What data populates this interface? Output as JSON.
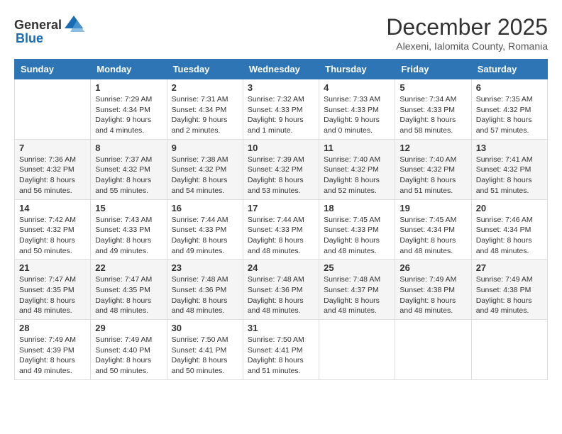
{
  "header": {
    "logo_general": "General",
    "logo_blue": "Blue",
    "month_title": "December 2025",
    "subtitle": "Alexeni, Ialomita County, Romania"
  },
  "days_of_week": [
    "Sunday",
    "Monday",
    "Tuesday",
    "Wednesday",
    "Thursday",
    "Friday",
    "Saturday"
  ],
  "weeks": [
    [
      {
        "day": "",
        "info": ""
      },
      {
        "day": "1",
        "info": "Sunrise: 7:29 AM\nSunset: 4:34 PM\nDaylight: 9 hours\nand 4 minutes."
      },
      {
        "day": "2",
        "info": "Sunrise: 7:31 AM\nSunset: 4:34 PM\nDaylight: 9 hours\nand 2 minutes."
      },
      {
        "day": "3",
        "info": "Sunrise: 7:32 AM\nSunset: 4:33 PM\nDaylight: 9 hours\nand 1 minute."
      },
      {
        "day": "4",
        "info": "Sunrise: 7:33 AM\nSunset: 4:33 PM\nDaylight: 9 hours\nand 0 minutes."
      },
      {
        "day": "5",
        "info": "Sunrise: 7:34 AM\nSunset: 4:33 PM\nDaylight: 8 hours\nand 58 minutes."
      },
      {
        "day": "6",
        "info": "Sunrise: 7:35 AM\nSunset: 4:32 PM\nDaylight: 8 hours\nand 57 minutes."
      }
    ],
    [
      {
        "day": "7",
        "info": "Sunrise: 7:36 AM\nSunset: 4:32 PM\nDaylight: 8 hours\nand 56 minutes."
      },
      {
        "day": "8",
        "info": "Sunrise: 7:37 AM\nSunset: 4:32 PM\nDaylight: 8 hours\nand 55 minutes."
      },
      {
        "day": "9",
        "info": "Sunrise: 7:38 AM\nSunset: 4:32 PM\nDaylight: 8 hours\nand 54 minutes."
      },
      {
        "day": "10",
        "info": "Sunrise: 7:39 AM\nSunset: 4:32 PM\nDaylight: 8 hours\nand 53 minutes."
      },
      {
        "day": "11",
        "info": "Sunrise: 7:40 AM\nSunset: 4:32 PM\nDaylight: 8 hours\nand 52 minutes."
      },
      {
        "day": "12",
        "info": "Sunrise: 7:40 AM\nSunset: 4:32 PM\nDaylight: 8 hours\nand 51 minutes."
      },
      {
        "day": "13",
        "info": "Sunrise: 7:41 AM\nSunset: 4:32 PM\nDaylight: 8 hours\nand 51 minutes."
      }
    ],
    [
      {
        "day": "14",
        "info": "Sunrise: 7:42 AM\nSunset: 4:32 PM\nDaylight: 8 hours\nand 50 minutes."
      },
      {
        "day": "15",
        "info": "Sunrise: 7:43 AM\nSunset: 4:33 PM\nDaylight: 8 hours\nand 49 minutes."
      },
      {
        "day": "16",
        "info": "Sunrise: 7:44 AM\nSunset: 4:33 PM\nDaylight: 8 hours\nand 49 minutes."
      },
      {
        "day": "17",
        "info": "Sunrise: 7:44 AM\nSunset: 4:33 PM\nDaylight: 8 hours\nand 48 minutes."
      },
      {
        "day": "18",
        "info": "Sunrise: 7:45 AM\nSunset: 4:33 PM\nDaylight: 8 hours\nand 48 minutes."
      },
      {
        "day": "19",
        "info": "Sunrise: 7:45 AM\nSunset: 4:34 PM\nDaylight: 8 hours\nand 48 minutes."
      },
      {
        "day": "20",
        "info": "Sunrise: 7:46 AM\nSunset: 4:34 PM\nDaylight: 8 hours\nand 48 minutes."
      }
    ],
    [
      {
        "day": "21",
        "info": "Sunrise: 7:47 AM\nSunset: 4:35 PM\nDaylight: 8 hours\nand 48 minutes."
      },
      {
        "day": "22",
        "info": "Sunrise: 7:47 AM\nSunset: 4:35 PM\nDaylight: 8 hours\nand 48 minutes."
      },
      {
        "day": "23",
        "info": "Sunrise: 7:48 AM\nSunset: 4:36 PM\nDaylight: 8 hours\nand 48 minutes."
      },
      {
        "day": "24",
        "info": "Sunrise: 7:48 AM\nSunset: 4:36 PM\nDaylight: 8 hours\nand 48 minutes."
      },
      {
        "day": "25",
        "info": "Sunrise: 7:48 AM\nSunset: 4:37 PM\nDaylight: 8 hours\nand 48 minutes."
      },
      {
        "day": "26",
        "info": "Sunrise: 7:49 AM\nSunset: 4:38 PM\nDaylight: 8 hours\nand 48 minutes."
      },
      {
        "day": "27",
        "info": "Sunrise: 7:49 AM\nSunset: 4:38 PM\nDaylight: 8 hours\nand 49 minutes."
      }
    ],
    [
      {
        "day": "28",
        "info": "Sunrise: 7:49 AM\nSunset: 4:39 PM\nDaylight: 8 hours\nand 49 minutes."
      },
      {
        "day": "29",
        "info": "Sunrise: 7:49 AM\nSunset: 4:40 PM\nDaylight: 8 hours\nand 50 minutes."
      },
      {
        "day": "30",
        "info": "Sunrise: 7:50 AM\nSunset: 4:41 PM\nDaylight: 8 hours\nand 50 minutes."
      },
      {
        "day": "31",
        "info": "Sunrise: 7:50 AM\nSunset: 4:41 PM\nDaylight: 8 hours\nand 51 minutes."
      },
      {
        "day": "",
        "info": ""
      },
      {
        "day": "",
        "info": ""
      },
      {
        "day": "",
        "info": ""
      }
    ]
  ]
}
